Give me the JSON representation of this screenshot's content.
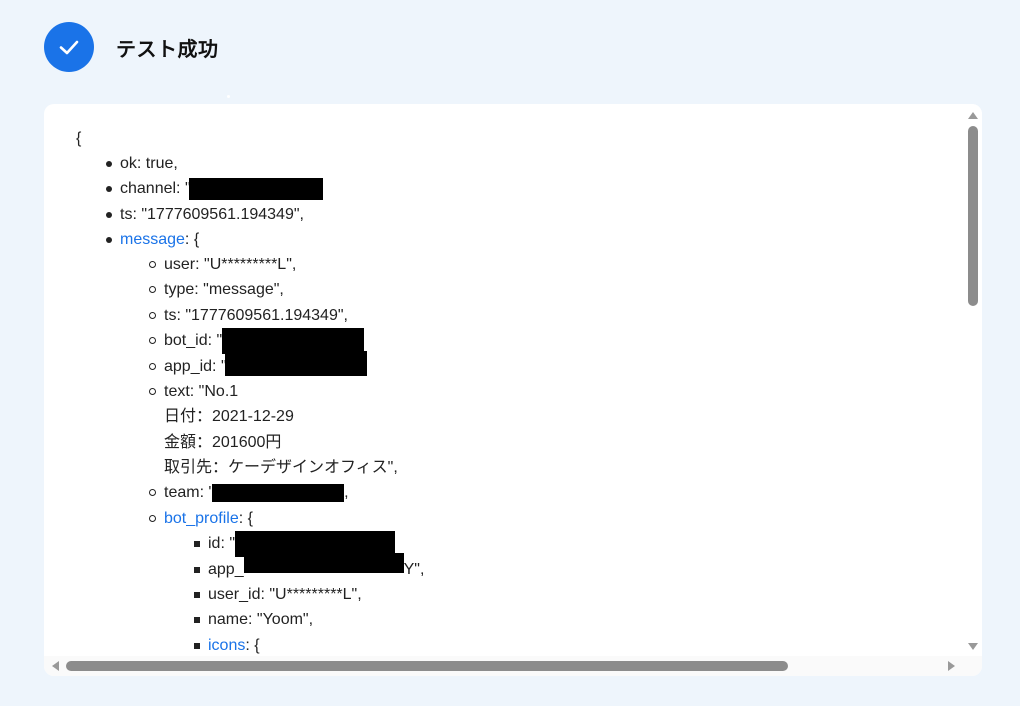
{
  "header": {
    "title": "テスト成功",
    "status_icon": "check-circle-icon"
  },
  "json_view": {
    "brace_open": "{",
    "ok": "ok: true,",
    "channel_prefix": "channel: \"",
    "ts": "ts: \"1777609561.194349\",",
    "message_key": "message",
    "message_suffix": ": {",
    "message": {
      "user": "user: \"U*********L\",",
      "type": "type: \"message\",",
      "ts": "ts: \"1777609561.194349\",",
      "bot_id_prefix": "bot_id: \"",
      "app_id_prefix": "app_id: \"",
      "text": "text: \"No.1\n日付：2021-12-29\n金額：201600円\n取引先：ケーデザインオフィス\",",
      "team_prefix": "team: \"",
      "team_suffix": ",",
      "bot_profile_key": "bot_profile",
      "bot_profile_suffix": ": {",
      "bot_profile": {
        "id_prefix": "id: \"",
        "app_prefix": "app_",
        "app_suffix": "Y\",",
        "user_id": "user_id: \"U*********L\",",
        "name": "name: \"Yoom\",",
        "icons_key": "icons",
        "icons_suffix": ": {"
      }
    }
  },
  "colors": {
    "accent": "#1a73e8",
    "background": "#eef5fc",
    "panel": "#ffffff"
  }
}
